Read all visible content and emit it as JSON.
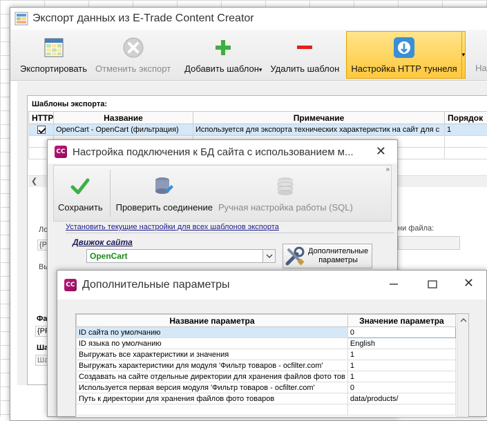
{
  "main_window": {
    "title": "Экспорт данных из E-Trade Content Creator",
    "toolbar": {
      "export": "Экспортировать",
      "cancel_export": "Отменить экспорт",
      "add_template": "Добавить шаблон",
      "add_template_arrow": "▾",
      "delete_template": "Удалить шаблон",
      "http_tunnel": "Настройка HTTP туннеля",
      "http_tunnel_arrow": "▾",
      "cut_off": "Наст"
    },
    "templates_label": "Шаблоны экспорта:",
    "templates_table": {
      "columns": [
        "HTTP",
        "Название",
        "Примечание",
        "Порядок"
      ],
      "rows": [
        {
          "http_checked": true,
          "name": "OpenCart - OpenCart (фильтрация)",
          "note": "Используется для экспорта технических характеристик на сайт для с",
          "order": "1"
        }
      ]
    },
    "partial_labels": {
      "lo": "Ло",
      "pr1": "{PR",
      "vy": "Вы",
      "fa": "Фа",
      "pr2": "{PR",
      "sha": "Шаб",
      "sh": "Ша",
      "file_name": "ни файла:"
    }
  },
  "db_window": {
    "title": "Настройка подключения к БД сайта с использованием м...",
    "toolbar": {
      "save": "Сохранить",
      "check_connection": "Проверить соединение",
      "manual_sql": "Ручная настройка работы (SQL)",
      "more": "»"
    },
    "apply_all_link": "Установить текущие настройки для всех шаблонов экспорта",
    "engine_label": "Движок сайта",
    "engine_value": "OpenCart",
    "extra_params_button": {
      "line1": "Дополнительные",
      "line2": "параметры"
    }
  },
  "params_window": {
    "title": "Дополнительные параметры",
    "columns": [
      "Название параметра",
      "Значение параметра"
    ],
    "rows": [
      {
        "name": "ID сайта по умолчанию",
        "value": "0"
      },
      {
        "name": "ID языка по умолчанию",
        "value": "English"
      },
      {
        "name": "Выгружать все характеристики и значения",
        "value": "1"
      },
      {
        "name": "Выгружать характеристики для модуля 'Фильтр товаров - ocfilter.com'",
        "value": "1"
      },
      {
        "name": "Создавать на сайте отдельные директории для хранения файлов фото тов",
        "value": "1"
      },
      {
        "name": "Используется первая версия модуля 'Фильтр товаров - ocfilter.com'",
        "value": "0"
      },
      {
        "name": "Путь к директории для хранения файлов фото товаров",
        "value": "data/products/"
      }
    ]
  },
  "colors": {
    "accent_active": "#ffc83d",
    "selected_row": "#d5e8f8",
    "engine_green": "#1a8a1a",
    "app_icon": "#c0187a"
  }
}
